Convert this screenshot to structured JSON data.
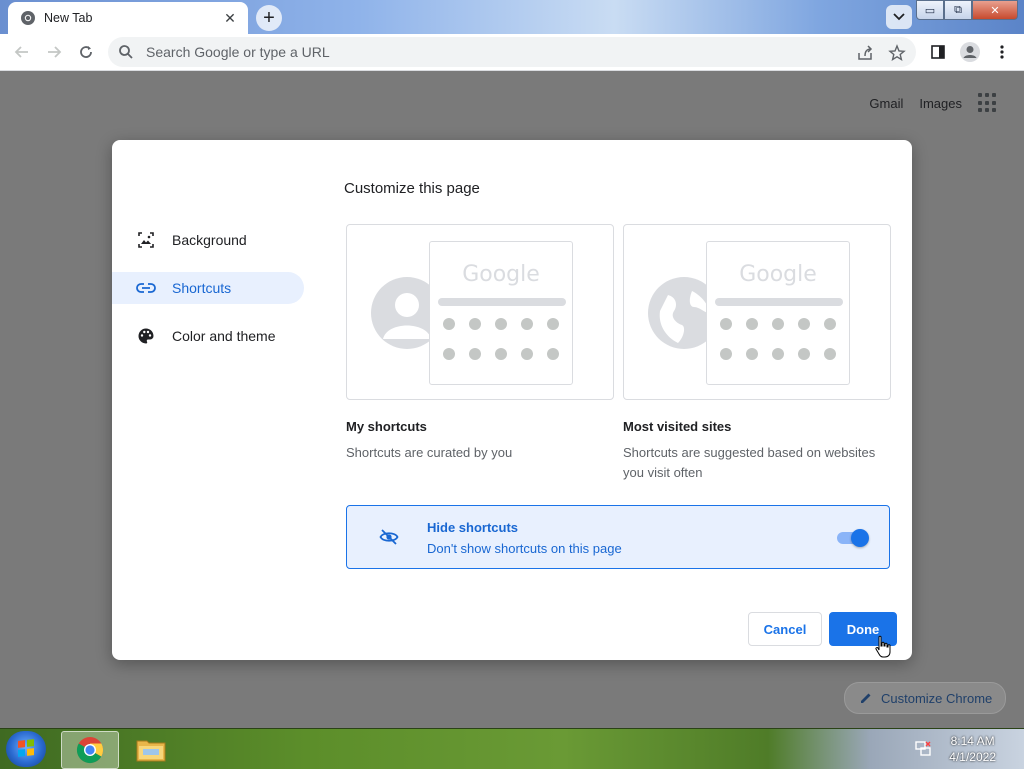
{
  "browser": {
    "tab_title": "New Tab",
    "tab_close": "✕",
    "new_tab": "+",
    "window_min": "▭",
    "window_max": "⧉",
    "window_close": "✕",
    "omnibox_placeholder": "Search Google or type a URL"
  },
  "ntp": {
    "gmail": "Gmail",
    "images": "Images",
    "customize_chrome": "Customize Chrome"
  },
  "dialog": {
    "title": "Customize this page",
    "sidebar": [
      {
        "label": "Background",
        "icon": "image-icon"
      },
      {
        "label": "Shortcuts",
        "icon": "link-icon",
        "selected": true
      },
      {
        "label": "Color and theme",
        "icon": "palette-icon"
      }
    ],
    "cards": [
      {
        "title": "My shortcuts",
        "desc": "Shortcuts are curated by you",
        "logo": "Google"
      },
      {
        "title": "Most visited sites",
        "desc": "Shortcuts are suggested based on websites you visit often",
        "logo": "Google"
      }
    ],
    "hide_shortcuts": {
      "title": "Hide shortcuts",
      "subtitle": "Don't show shortcuts on this page",
      "enabled": true
    },
    "cancel": "Cancel",
    "done": "Done"
  },
  "taskbar": {
    "time": "8:14 AM",
    "date": "4/1/2022"
  },
  "colors": {
    "accent": "#1a73e8",
    "selected_bg": "#e8f0fe"
  }
}
